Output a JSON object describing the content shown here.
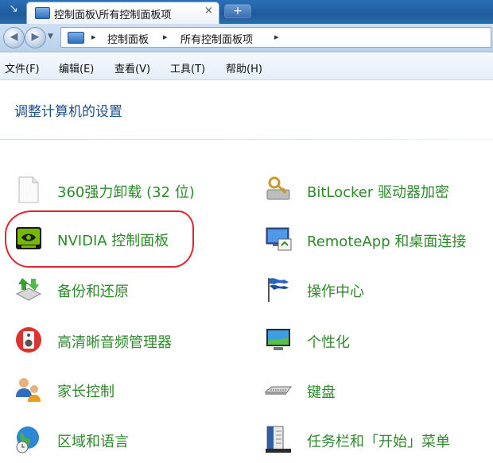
{
  "tab": {
    "title": "控制面板\\所有控制面板项",
    "close": "×",
    "new_tab": "+"
  },
  "address_bar": {
    "crumbs": [
      "控制面板",
      "所有控制面板项"
    ],
    "separator": "▸"
  },
  "menu": [
    "文件(F)",
    "编辑(E)",
    "查看(V)",
    "工具(T)",
    "帮助(H)"
  ],
  "heading": "调整计算机的设置",
  "items_left": [
    {
      "label": "360强力卸载 (32 位)",
      "icon": "blank-document-icon"
    },
    {
      "label": "NVIDIA 控制面板",
      "icon": "nvidia-icon"
    },
    {
      "label": "备份和还原",
      "icon": "backup-icon"
    },
    {
      "label": "高清晰音频管理器",
      "icon": "audio-speaker-icon"
    },
    {
      "label": "家长控制",
      "icon": "parental-control-icon"
    },
    {
      "label": "区域和语言",
      "icon": "globe-clock-icon"
    }
  ],
  "items_right": [
    {
      "label": "BitLocker 驱动器加密",
      "icon": "bitlocker-key-icon"
    },
    {
      "label": "RemoteApp 和桌面连接",
      "icon": "remoteapp-icon"
    },
    {
      "label": "操作中心",
      "icon": "action-center-flag-icon"
    },
    {
      "label": "个性化",
      "icon": "personalization-monitor-icon"
    },
    {
      "label": "键盘",
      "icon": "keyboard-icon"
    },
    {
      "label": "任务栏和「开始」菜单",
      "icon": "taskbar-start-menu-icon"
    }
  ],
  "colors": {
    "link_green": "#2e8a2a",
    "heading_blue": "#1c4e8c",
    "annotation_red": "#e0262e"
  }
}
